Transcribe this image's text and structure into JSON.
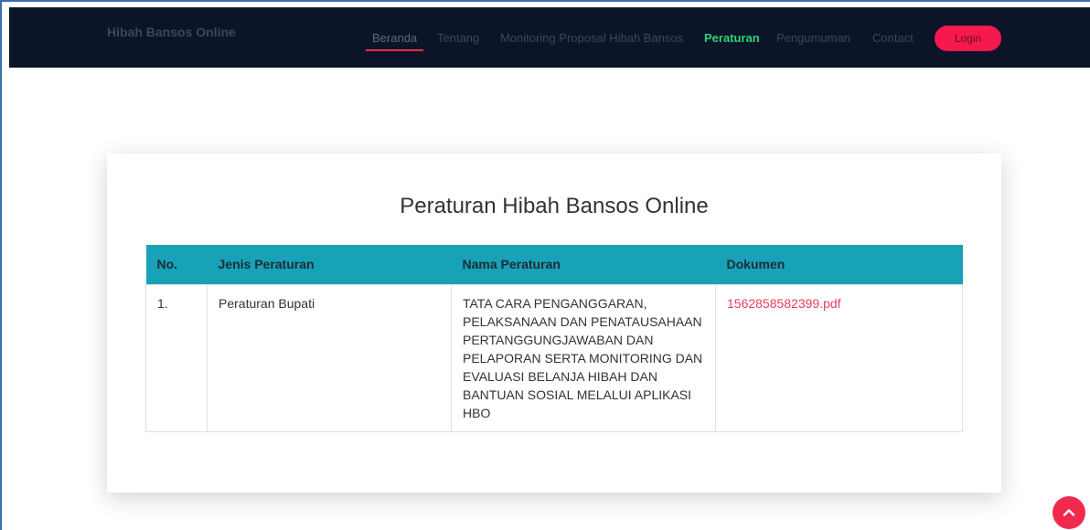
{
  "navbar": {
    "brand": "Hibah Bansos Online",
    "links": [
      "Beranda",
      "Tentang",
      "Monitoring Proposal Hibah Bansos",
      "Peraturan",
      "Pengumuman",
      "Contact"
    ],
    "active_link": "Peraturan",
    "login_label": "Login",
    "accent_color": "#f5194c",
    "active_color": "#2ed573"
  },
  "page": {
    "title": "Peraturan Hibah Bansos Online"
  },
  "table": {
    "headers": [
      "No.",
      "Jenis Peraturan",
      "Nama Peraturan",
      "Dokumen"
    ],
    "header_color": "#17a2b8",
    "rows": [
      {
        "no": "1.",
        "jenis": "Peraturan Bupati",
        "nama": "TATA CARA PENGANGGARAN, PELAKSANAAN DAN PENATAUSAHAAN PERTANGGUNGJAWABAN DAN PELAPORAN SERTA MONITORING DAN EVALUASI BELANJA HIBAH DAN BANTUAN SOSIAL MELALUI APLIKASI HBO",
        "dokumen": "1562858582399.pdf"
      }
    ]
  },
  "scroll_top_icon": "chevron-up-icon"
}
